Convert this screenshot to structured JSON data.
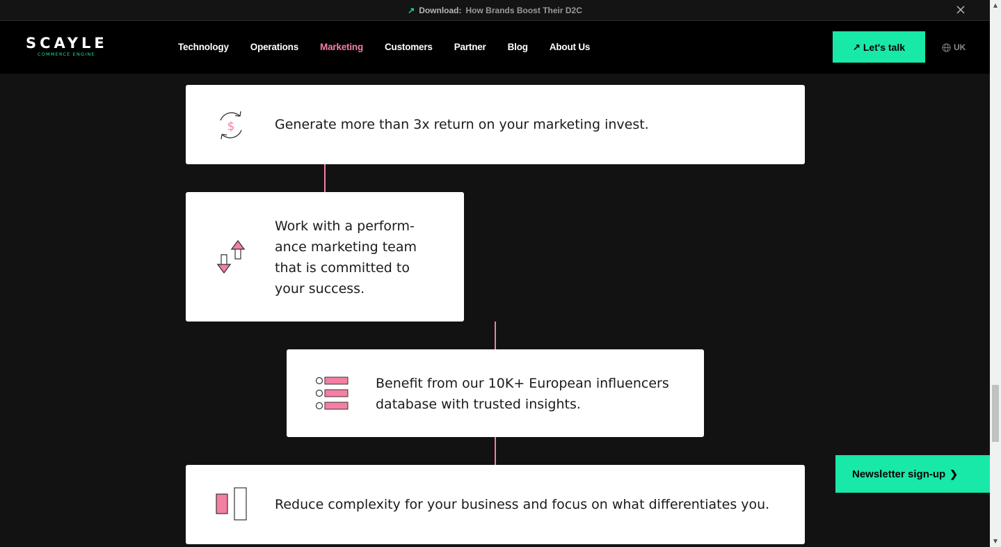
{
  "announcement": {
    "arrow_icon": "arrow-up-right-icon",
    "label": "Download:",
    "text": "How Brands Boost Their D2C",
    "close_icon": "close-icon"
  },
  "header": {
    "logo_word": "SCAYLE",
    "logo_sub": "COMMERCE ENGINE",
    "nav": [
      "Technology",
      "Operations",
      "Marketing",
      "Customers",
      "Partner",
      "Blog",
      "About Us"
    ],
    "active_nav": "Marketing",
    "cta_label": "Let's talk",
    "lang": "UK"
  },
  "cards": [
    {
      "icon": "dollar-refresh-icon",
      "text": "Generate more than 3x return on your marketing invest."
    },
    {
      "icon": "up-down-arrows-icon",
      "text": "Work with a perform-\nance marketing team that is committed to your success."
    },
    {
      "icon": "checklist-icon",
      "text": "Benefit from our 10K+ European influencers database with trusted insights."
    },
    {
      "icon": "bar-compare-icon",
      "text": "Reduce complexity for your business and focus on what differentiates you."
    }
  ],
  "newsletter": {
    "label": "Newsletter sign-up",
    "chevron": "chevron-right-icon"
  },
  "colors": {
    "accent": "#18e8a8",
    "pink": "#f57fa3",
    "bg": "#121212"
  }
}
